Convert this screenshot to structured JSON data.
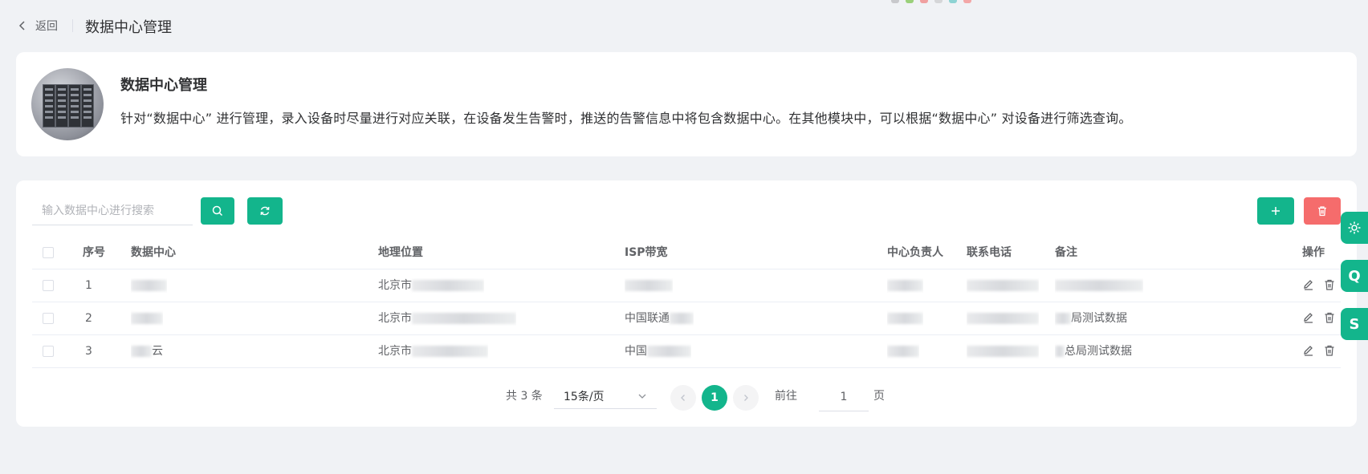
{
  "header": {
    "back_label": "返回",
    "title": "数据中心管理"
  },
  "intro": {
    "title": "数据中心管理",
    "description": "针对“数据中心” 进行管理，录入设备时尽量进行对应关联，在设备发生告警时，推送的告警信息中将包含数据中心。在其他模块中，可以根据“数据中心” 对设备进行筛选查询。"
  },
  "toolbar": {
    "search_placeholder": "输入数据中心进行搜索"
  },
  "table": {
    "headers": {
      "index": "序号",
      "name": "数据中心",
      "location": "地理位置",
      "isp": "ISP带宽",
      "owner": "中心负责人",
      "phone": "联系电话",
      "remark": "备注",
      "actions": "操作"
    },
    "rows": [
      {
        "index": "1",
        "name": "",
        "location": "北京市",
        "isp": "",
        "owner": "",
        "phone": "",
        "remark": ""
      },
      {
        "index": "2",
        "name": "",
        "location": "北京市",
        "isp": "中国联通",
        "owner": "",
        "phone": "",
        "remark": "局测试数据"
      },
      {
        "index": "3",
        "name": "云",
        "location": "北京市",
        "isp": "中国",
        "owner": "",
        "phone": "",
        "remark": "总局测试数据"
      }
    ]
  },
  "pagination": {
    "total_text": "共 3 条",
    "page_size": "15条/页",
    "current_page": "1",
    "goto_prefix": "前往",
    "goto_value": "1",
    "goto_suffix": "页"
  },
  "side_tools": {
    "q_label": "Q",
    "s_label": "S"
  },
  "colors": {
    "accent": "#13b58c",
    "danger": "#f56c6c",
    "background": "#f0f2f5"
  }
}
